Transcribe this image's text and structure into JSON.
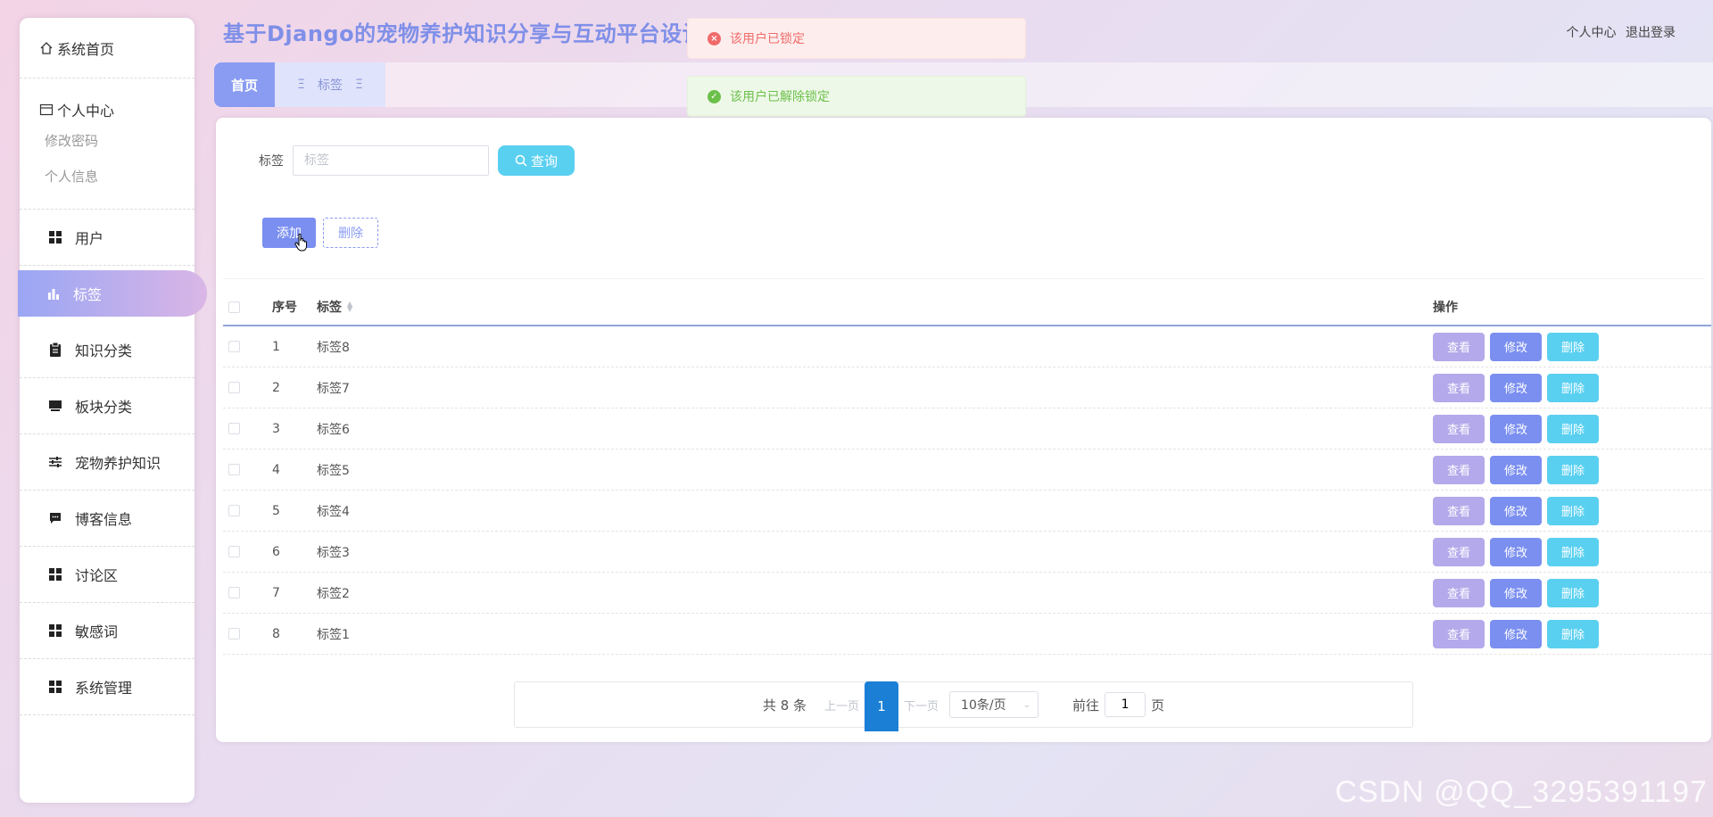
{
  "app": {
    "title": "基于Django的宠物养护知识分享与互动平台设计"
  },
  "header": {
    "personal_center": "个人中心",
    "logout": "退出登录"
  },
  "toasts": {
    "error": {
      "text": "该用户已锁定",
      "icon": "error-circle-icon",
      "color": "#f06a6a"
    },
    "success": {
      "text": "该用户已解除锁定",
      "icon": "check-circle-icon",
      "color": "#6cc04a"
    }
  },
  "tabs": {
    "home": "首页",
    "current": "标签"
  },
  "sidebar": {
    "home": "系统首页",
    "personal": {
      "title": "个人中心",
      "children": [
        "修改密码",
        "个人信息"
      ]
    },
    "items": [
      {
        "label": "用户",
        "icon": "grid-icon"
      },
      {
        "label": "标签",
        "icon": "bar-chart-icon",
        "active": true
      },
      {
        "label": "知识分类",
        "icon": "clipboard-icon"
      },
      {
        "label": "板块分类",
        "icon": "monitor-icon"
      },
      {
        "label": "宠物养护知识",
        "icon": "sliders-icon"
      },
      {
        "label": "博客信息",
        "icon": "comment-icon"
      },
      {
        "label": "讨论区",
        "icon": "grid-icon"
      },
      {
        "label": "敏感词",
        "icon": "grid-icon"
      },
      {
        "label": "系统管理",
        "icon": "grid-icon"
      }
    ]
  },
  "search": {
    "label": "标签",
    "placeholder": "标签",
    "button": "查询"
  },
  "actions": {
    "add": "添加",
    "delete": "删除"
  },
  "table": {
    "columns": {
      "index": "序号",
      "tag": "标签",
      "ops": "操作"
    },
    "rows": [
      {
        "index": "1",
        "tag": "标签8"
      },
      {
        "index": "2",
        "tag": "标签7"
      },
      {
        "index": "3",
        "tag": "标签6"
      },
      {
        "index": "4",
        "tag": "标签5"
      },
      {
        "index": "5",
        "tag": "标签4"
      },
      {
        "index": "6",
        "tag": "标签3"
      },
      {
        "index": "7",
        "tag": "标签2"
      },
      {
        "index": "8",
        "tag": "标签1"
      }
    ],
    "op_labels": {
      "view": "查看",
      "edit": "修改",
      "delete": "删除"
    }
  },
  "pagination": {
    "total": "共 8 条",
    "prev": "上一页",
    "page": "1",
    "next": "下一页",
    "page_size": "10条/页",
    "goto_prefix": "前往",
    "goto_value": "1",
    "goto_suffix": "页"
  },
  "watermark": "CSDN @QQ_3295391197"
}
